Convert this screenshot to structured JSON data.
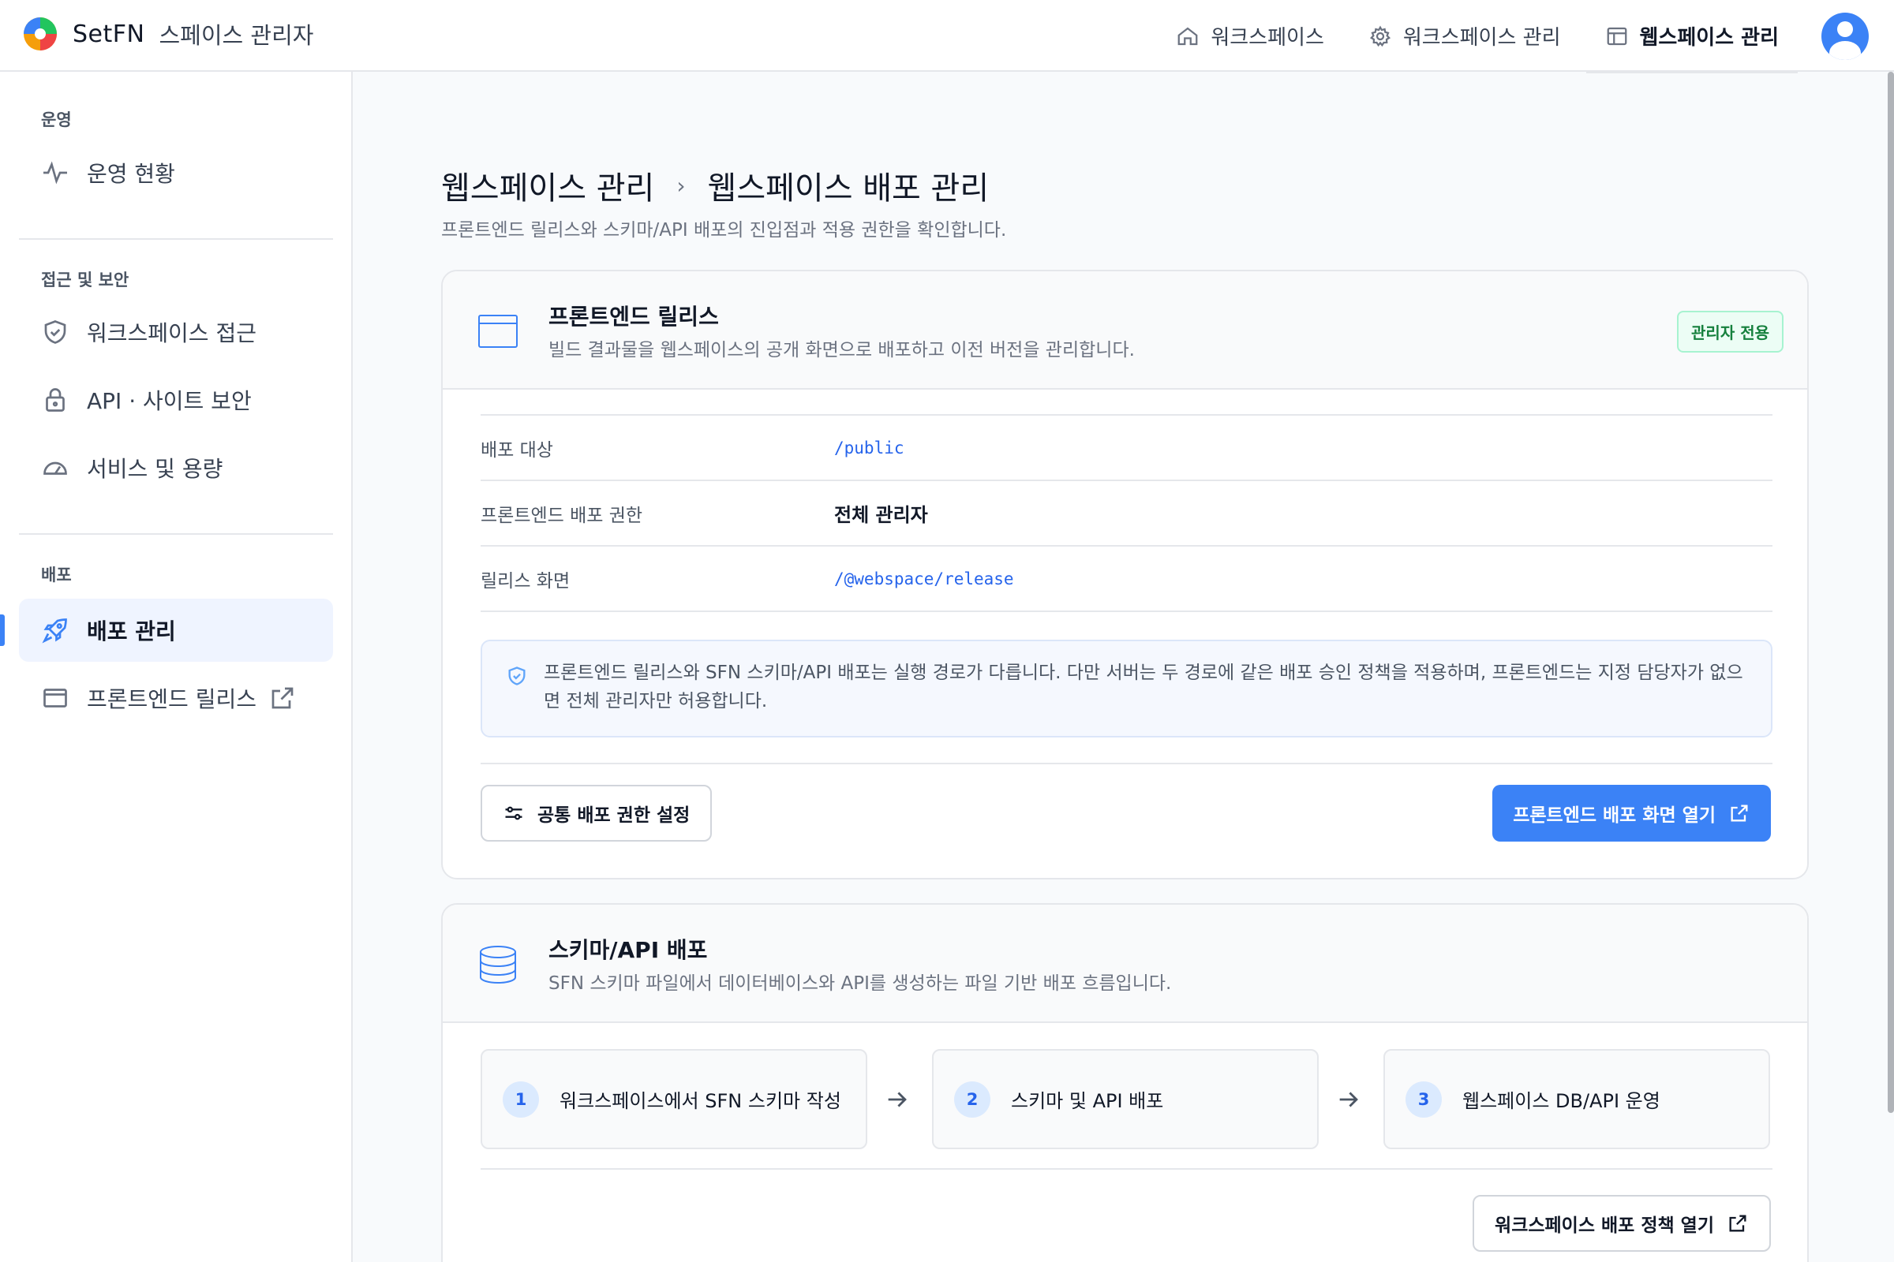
{
  "brand": {
    "name": "SetFN",
    "subtitle": "스페이스 관리자"
  },
  "topnav": [
    {
      "label": "워크스페이스",
      "icon": "home-icon"
    },
    {
      "label": "워크스페이스 관리",
      "icon": "gear-icon"
    },
    {
      "label": "웹스페이스 관리",
      "icon": "layout-icon",
      "active": true
    }
  ],
  "sidebar": {
    "sections": [
      {
        "title": "운영",
        "items": [
          {
            "label": "운영 현황",
            "icon": "activity-icon"
          }
        ]
      },
      {
        "title": "접근 및 보안",
        "items": [
          {
            "label": "워크스페이스 접근",
            "icon": "shield-icon"
          },
          {
            "label": "API · 사이트 보안",
            "icon": "lock-icon"
          },
          {
            "label": "서비스 및 용량",
            "icon": "gauge-icon"
          }
        ]
      },
      {
        "title": "배포",
        "items": [
          {
            "label": "배포 관리",
            "icon": "rocket-icon",
            "active": true
          },
          {
            "label": "프론트엔드 릴리스",
            "icon": "window-icon",
            "external": true
          }
        ]
      }
    ]
  },
  "page": {
    "breadcrumb": [
      "웹스페이스 관리",
      "웹스페이스 배포 관리"
    ],
    "breadcrumb_sep": "›",
    "description": "프론트엔드 릴리스와 스키마/API 배포의 진입점과 적용 권한을 확인합니다."
  },
  "release_card": {
    "title": "프론트엔드 릴리스",
    "subtitle": "빌드 결과물을 웹스페이스의 공개 화면으로 배포하고 이전 버전을 관리합니다.",
    "badge": "관리자 전용",
    "rows": [
      {
        "label": "배포 대상",
        "value": "/public"
      },
      {
        "label": "프론트엔드 배포 권한",
        "value": "전체 관리자"
      },
      {
        "label": "릴리스 화면",
        "value": "/@webspace/release"
      }
    ],
    "note": "프론트엔드 릴리스와 SFN 스키마/API 배포는 실행 경로가 다릅니다. 다만 서버는 두 경로에 같은 배포 승인 정책을 적용하며, 프론트엔드는 지정 담당자가 없으면 전체 관리자만 허용합니다.",
    "secondary_button": "공통 배포 권한 설정",
    "primary_button": "프론트엔드 배포 화면 열기"
  },
  "schema_card": {
    "title": "스키마/API 배포",
    "subtitle": "SFN 스키마 파일에서 데이터베이스와 API를 생성하는 파일 기반 배포 흐름입니다.",
    "steps": [
      {
        "num": "1",
        "label": "워크스페이스에서 SFN 스키마 작성"
      },
      {
        "num": "2",
        "label": "스키마 및 API 배포"
      },
      {
        "num": "3",
        "label": "웹스페이스 DB/API 운영"
      }
    ],
    "button": "워크스페이스 배포 정책 열기"
  },
  "colors": {
    "accent": "#3b82f6",
    "badge_green": "#15803d",
    "active_bg": "#eff4ff"
  }
}
